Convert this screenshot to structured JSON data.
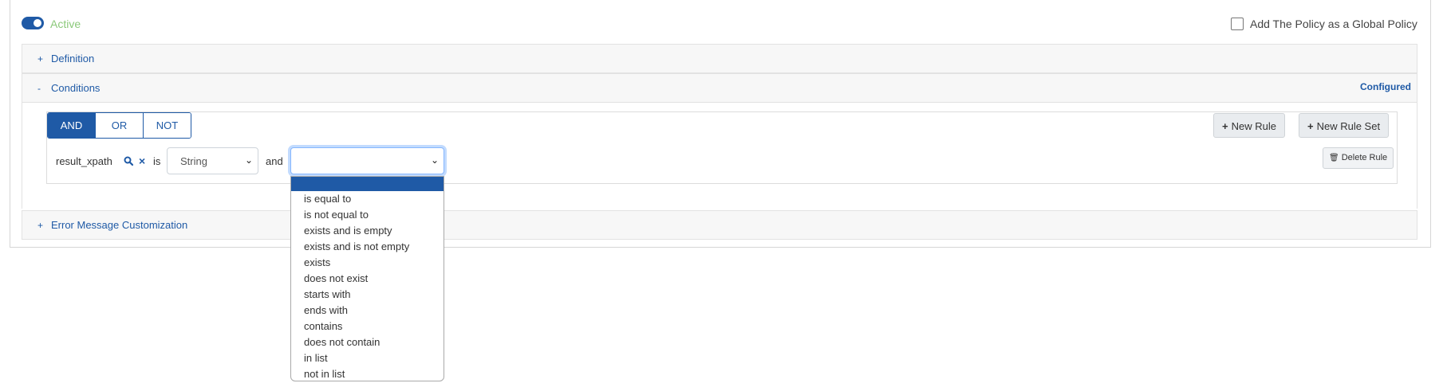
{
  "status": {
    "active_label": "Active",
    "active_on": true
  },
  "global_policy": {
    "label": "Add The Policy as a Global Policy",
    "checked": false
  },
  "sections": {
    "definition": {
      "sign": "+",
      "title": "Definition"
    },
    "conditions": {
      "sign": "-",
      "title": "Conditions",
      "badge": "Configured"
    },
    "error": {
      "sign": "+",
      "title": "Error Message Customization"
    }
  },
  "logic": {
    "options": [
      "AND",
      "OR",
      "NOT"
    ],
    "selected": "AND"
  },
  "actions": {
    "new_rule": "New Rule",
    "new_rule_set": "New Rule Set",
    "delete_rule": "Delete Rule",
    "plus": "+"
  },
  "rule": {
    "field": "result_xpath",
    "is_label": "is",
    "type_value": "String",
    "and_label": "and",
    "operator_value": ""
  },
  "operator_options": [
    "",
    "is equal to",
    "is not equal to",
    "exists and is empty",
    "exists and is not empty",
    "exists",
    "does not exist",
    "starts with",
    "ends with",
    "contains",
    "does not contain",
    "in list",
    "not in list"
  ],
  "colors": {
    "accent": "#1f5aa6",
    "active_text": "#8bc97a"
  },
  "icons": {
    "search": "search-icon",
    "clear": "close-icon",
    "chevron": "chevron-down-icon",
    "trash": "trash-icon"
  }
}
